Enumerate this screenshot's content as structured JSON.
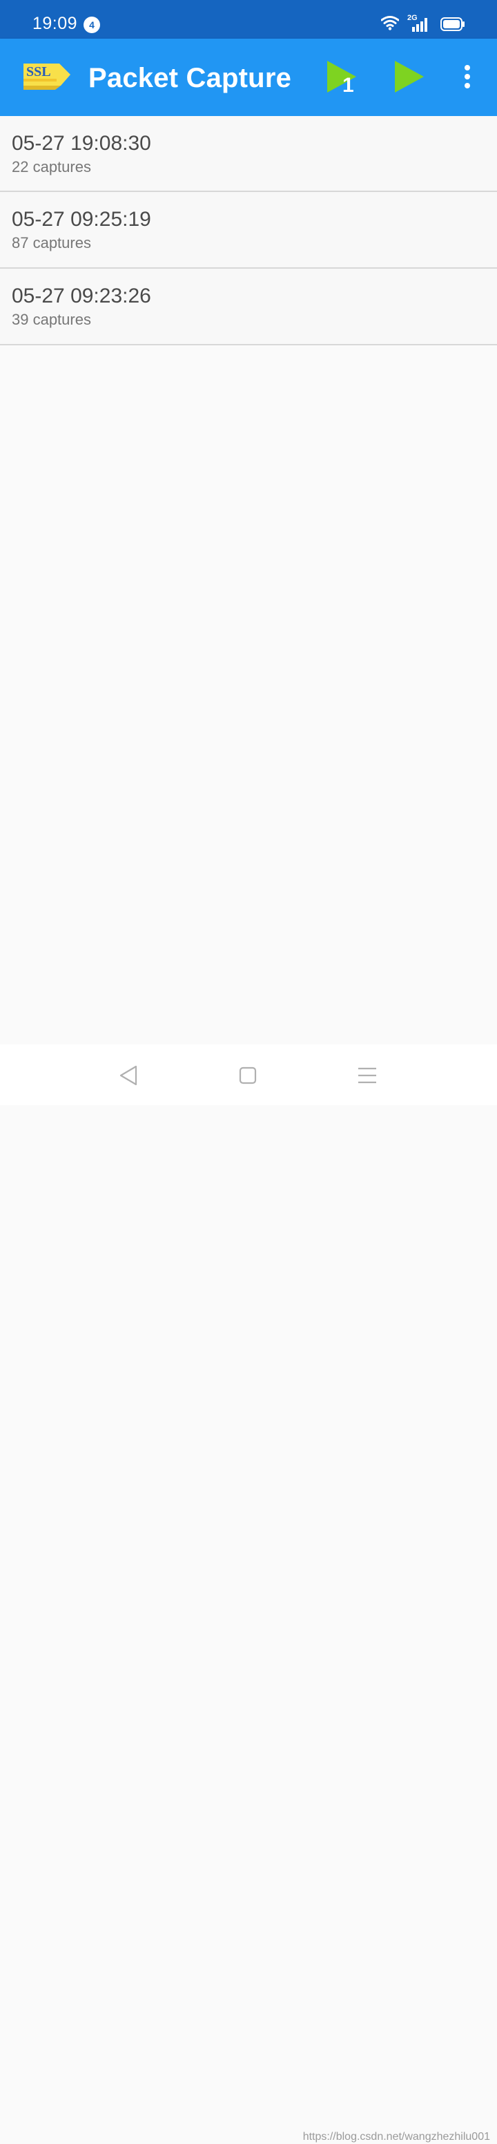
{
  "status_bar": {
    "time": "19:09",
    "notification_count": "4",
    "network_type": "2G",
    "icons": [
      "wifi-icon",
      "signal-icon",
      "battery-icon"
    ]
  },
  "app_bar": {
    "title": "Packet Capture",
    "logo_text": "SSL",
    "action_badge": "1",
    "actions": [
      "play-one-icon",
      "play-icon",
      "more-vert-icon"
    ],
    "colors": {
      "app_bar": "#2196f3",
      "status_bar": "#1565c0",
      "play_icon": "#7ed321",
      "logo": "#f8e04a"
    }
  },
  "sessions": [
    {
      "time": "05-27 19:08:30",
      "count": "22 captures"
    },
    {
      "time": "05-27 09:25:19",
      "count": "87 captures"
    },
    {
      "time": "05-27 09:23:26",
      "count": "39 captures"
    }
  ],
  "nav_bar": {
    "buttons": [
      "back-icon",
      "home-icon",
      "menu-icon"
    ]
  },
  "watermark": "https://blog.csdn.net/wangzhezhilu001"
}
